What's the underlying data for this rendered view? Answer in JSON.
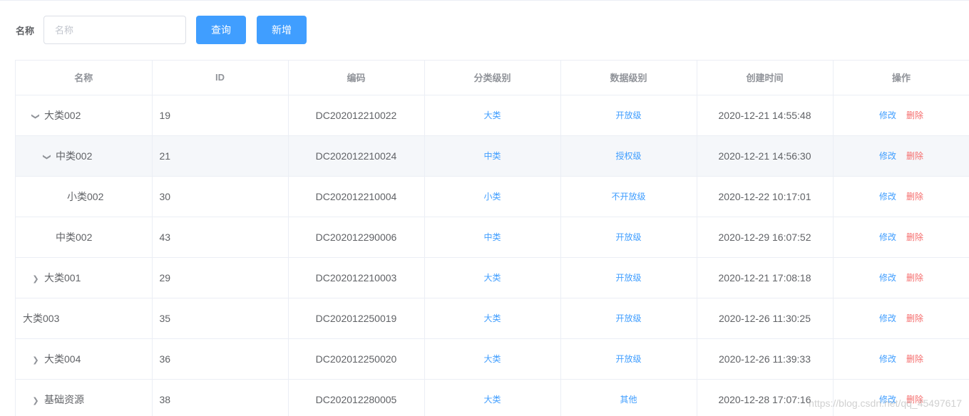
{
  "search": {
    "label": "名称",
    "placeholder": "名称",
    "value": ""
  },
  "buttons": {
    "query": "查询",
    "add": "新增"
  },
  "table": {
    "headers": [
      "名称",
      "ID",
      "编码",
      "分类级别",
      "数据级别",
      "创建时间",
      "操作"
    ],
    "rows": [
      {
        "level": 0,
        "toggle": "open",
        "name": "大类002",
        "id": "19",
        "code": "DC202012210022",
        "category": "大类",
        "data_level": "开放级",
        "created": "2020-12-21 14:55:48",
        "edit": "修改",
        "delete": "删除"
      },
      {
        "level": 1,
        "toggle": "open",
        "name": "中类002",
        "id": "21",
        "code": "DC202012210024",
        "category": "中类",
        "data_level": "授权级",
        "created": "2020-12-21 14:56:30",
        "edit": "修改",
        "delete": "删除",
        "highlight": true
      },
      {
        "level": 2,
        "toggle": "none",
        "name": "小类002",
        "id": "30",
        "code": "DC202012210004",
        "category": "小类",
        "data_level": "不开放级",
        "created": "2020-12-22 10:17:01",
        "edit": "修改",
        "delete": "删除"
      },
      {
        "level": 1,
        "toggle": "none",
        "name": "中类002",
        "id": "43",
        "code": "DC202012290006",
        "category": "中类",
        "data_level": "开放级",
        "created": "2020-12-29 16:07:52",
        "edit": "修改",
        "delete": "删除"
      },
      {
        "level": 0,
        "toggle": "closed",
        "name": "大类001",
        "id": "29",
        "code": "DC202012210003",
        "category": "大类",
        "data_level": "开放级",
        "created": "2020-12-21 17:08:18",
        "edit": "修改",
        "delete": "删除"
      },
      {
        "level": 0,
        "toggle": "leaf",
        "name": "大类003",
        "id": "35",
        "code": "DC202012250019",
        "category": "大类",
        "data_level": "开放级",
        "created": "2020-12-26 11:30:25",
        "edit": "修改",
        "delete": "删除"
      },
      {
        "level": 0,
        "toggle": "closed",
        "name": "大类004",
        "id": "36",
        "code": "DC202012250020",
        "category": "大类",
        "data_level": "开放级",
        "created": "2020-12-26 11:39:33",
        "edit": "修改",
        "delete": "删除"
      },
      {
        "level": 0,
        "toggle": "closed",
        "name": "基础资源",
        "id": "38",
        "code": "DC202012280005",
        "category": "大类",
        "data_level": "其他",
        "created": "2020-12-28 17:07:16",
        "edit": "修改",
        "delete": "删除"
      }
    ]
  },
  "watermark": "https://blog.csdn.net/qq_45497617",
  "colors": {
    "primary": "#409eff",
    "danger": "#f56c6c",
    "border": "#ebeef5",
    "row_highlight": "#f5f7fa"
  }
}
